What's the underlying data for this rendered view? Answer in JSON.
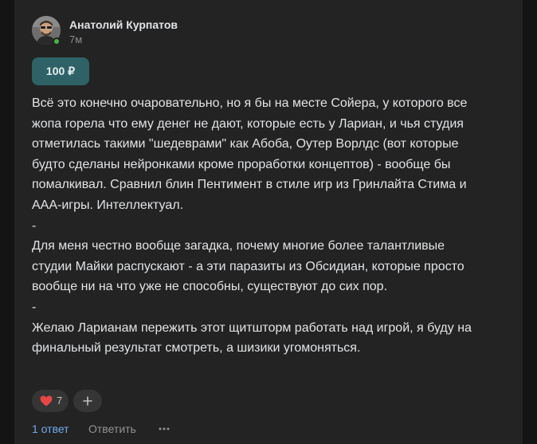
{
  "comment": {
    "author": "Анатолий Курпатов",
    "time": "7м",
    "online": true,
    "donation": "100 ₽",
    "paragraphs": [
      "Всё это конечно очаровательно, но я бы на месте Сойера, у которого все жопа горела что ему денег не дают, которые есть у Лариан, и чья студия отметилась такими \"шедеврами\" как Абоба, Оутер Ворлдс (вот которые будто сделаны нейронками кроме проработки концептов) - вообще бы помалкивал. Сравнил блин Пентимент в стиле игр из Гринлайта Стима и ААА-игры. Интеллектуал.",
      "-",
      "Для меня честно вообще загадка, почему многие более талантливые студии Майки распускают - а эти паразиты из Обсидиан, которые просто вообще ни на что уже не способны, существуют до сих пор.",
      "-",
      "Желаю Ларианам пережить этот щитшторм работать над игрой, я буду на финальный результат смотреть, а шизики угомоняться."
    ]
  },
  "reactions": {
    "icon": "heart-icon",
    "count": "7",
    "add_icon": "plus-icon"
  },
  "actions": {
    "replies_label": "1 ответ",
    "reply_label": "Ответить",
    "more_icon": "ellipsis-icon"
  },
  "colors": {
    "background": "#141414",
    "card": "#232323",
    "link": "#71aaeb",
    "badge": "#2e6266",
    "online": "#4bb34b",
    "heart": "#e64646"
  }
}
